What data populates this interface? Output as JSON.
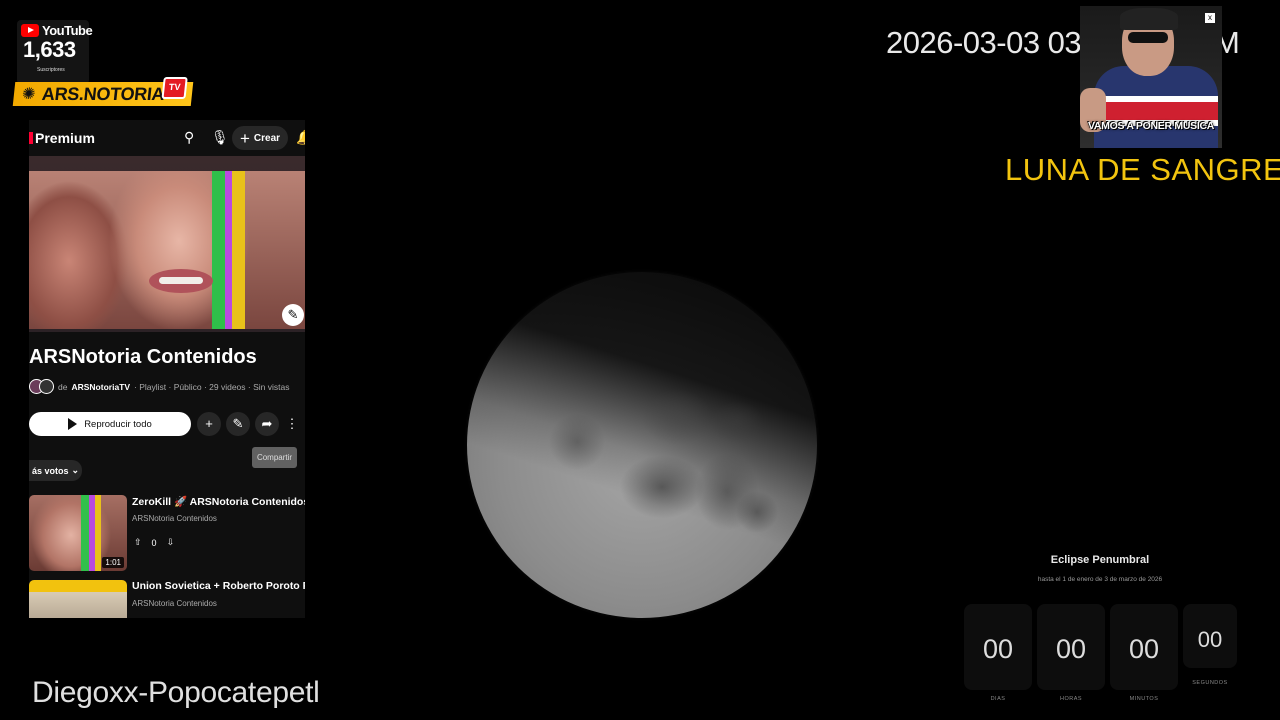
{
  "yt_badge": {
    "brand": "YouTube",
    "subscriber_count": "1,633",
    "subscriber_label": "Suscriptores"
  },
  "ars_logo": {
    "text": "ARS.NOTORIA",
    "tv_label": "TV"
  },
  "youtube_panel": {
    "topbar": {
      "brand": "Premium",
      "create_label": "Crear"
    },
    "playlist": {
      "title": "ARSNotoria Contenidos",
      "owner_prefix": "de",
      "owner": "ARSNotoriaTV",
      "meta": "· Playlist · Público · 29 videos · Sin vistas"
    },
    "play_all_label": "Reproducir todo",
    "tooltip": "Compartir",
    "sort_label": "ás votos",
    "videos": [
      {
        "title": "ZeroKill 🚀 ARSNotoria Contenidos",
        "channel": "ARSNotoria Contenidos",
        "duration": "1:01",
        "likes": "0"
      },
      {
        "title": "Union Sovietica + Roberto Poroto Rie",
        "channel": "ARSNotoria Contenidos"
      }
    ]
  },
  "overlay": {
    "datetime": "2026-03-03 03",
    "datetime_tail": "M",
    "cam_caption": "VAMOS A PONER MUSICA",
    "close_label": "x",
    "headline": "LUNA DE SANGRE"
  },
  "countdown": {
    "title": "Eclipse Penumbral",
    "subtitle": "hasta el 1 de enero de 3 de marzo de 2026",
    "units": [
      {
        "value": "00",
        "label": "DIAS"
      },
      {
        "value": "00",
        "label": "HORAS"
      },
      {
        "value": "00",
        "label": "MINUTOS"
      },
      {
        "value": "00",
        "label": "SEGUNDOS"
      }
    ]
  },
  "footer": {
    "name": "Diegoxx-Popocatepetl"
  },
  "colors": {
    "accent_yellow": "#f2c40f",
    "youtube_red": "#ff0000",
    "panel_bg": "#0f0f0f"
  }
}
